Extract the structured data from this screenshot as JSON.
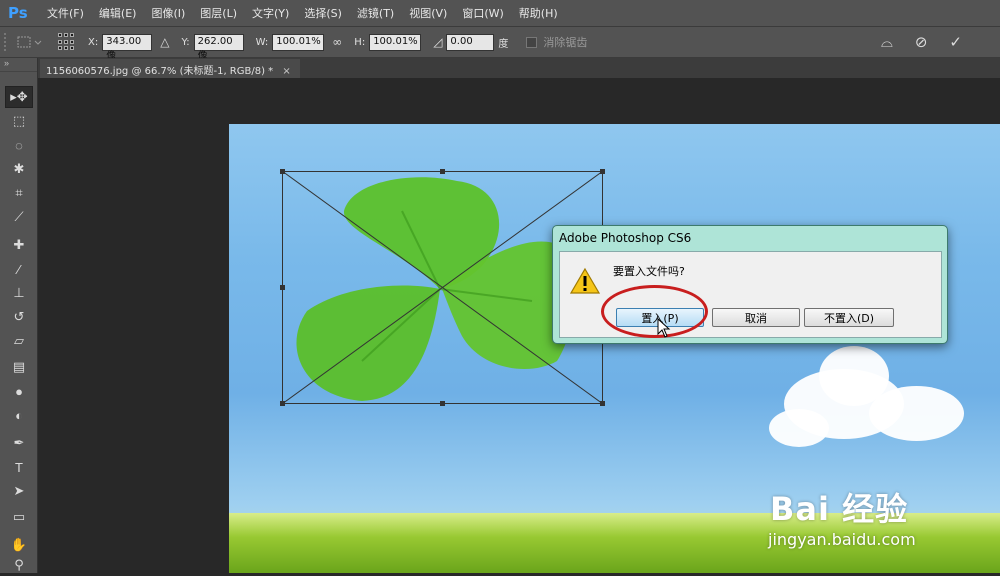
{
  "app": {
    "logo": "Ps"
  },
  "menu": [
    "文件(F)",
    "编辑(E)",
    "图像(I)",
    "图层(L)",
    "文字(Y)",
    "选择(S)",
    "滤镜(T)",
    "视图(V)",
    "窗口(W)",
    "帮助(H)"
  ],
  "options": {
    "x_label": "X:",
    "x_value": "343.00 像",
    "y_label": "Y:",
    "y_value": "262.00 像",
    "w_label": "W:",
    "w_value": "100.01%",
    "h_label": "H:",
    "h_value": "100.01%",
    "angle_value": "0.00",
    "angle_unit": "度",
    "antialias_label": "消除锯齿"
  },
  "document_tab": {
    "title": "1156060576.jpg @ 66.7% (未标题-1, RGB/8) *",
    "close": "×"
  },
  "dialog": {
    "title": "Adobe Photoshop CS6",
    "message": "要置入文件吗?",
    "place_label": "置入(P)",
    "cancel_label": "取消",
    "dont_place_label": "不置入(D)"
  },
  "watermark": {
    "logo_text": "Bai 经验",
    "url": "jingyan.baidu.com"
  },
  "colors": {
    "ps_blue": "#3fa0ff",
    "annotation_red": "#c81e1e"
  }
}
